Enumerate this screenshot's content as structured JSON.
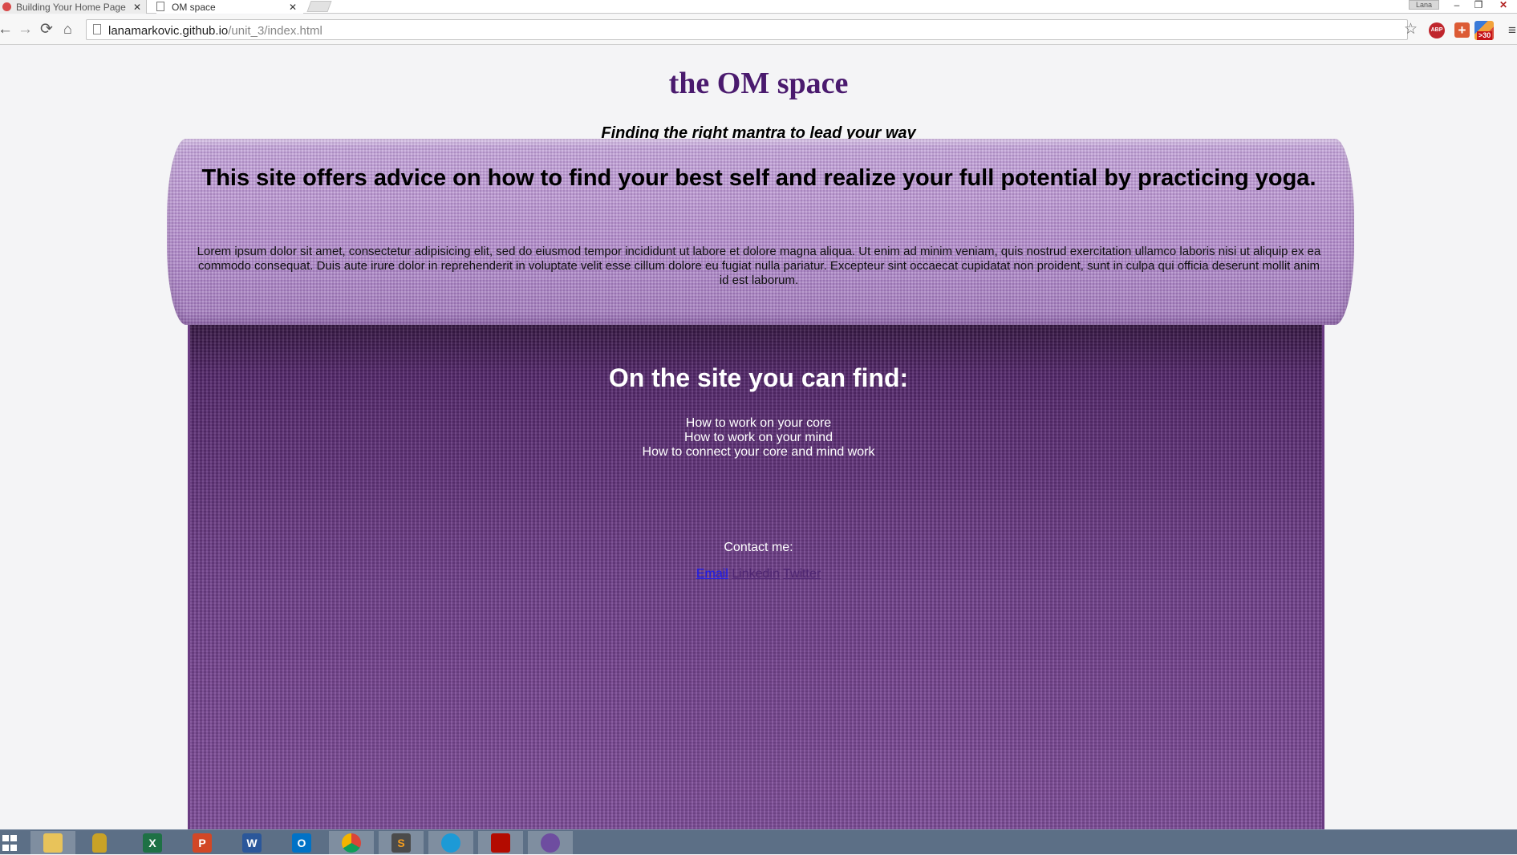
{
  "browser": {
    "tabs": [
      {
        "title": "Building Your Home Page",
        "active": false
      },
      {
        "title": "OM space",
        "active": true
      }
    ],
    "profile_name": "Lana",
    "url": {
      "host": "lanamarkovic.github.io",
      "path": "/unit_3/index.html"
    },
    "extensions": {
      "abp": "ABP",
      "chart_badge": ">30"
    },
    "close_glyph": "✕",
    "window": {
      "min": "–",
      "max": "❐",
      "close": "✕"
    },
    "nav": {
      "back": "←",
      "forward": "→",
      "reload": "⟳",
      "home": "⌂",
      "star": "☆",
      "menu": "≡"
    }
  },
  "page": {
    "title": "the OM space",
    "tagline": "Finding the right mantra to lead your way",
    "intro_heading": "This site offers advice on how to find your best self and realize your full potential by practicing yoga.",
    "intro_body": "Lorem ipsum dolor sit amet, consectetur adipisicing elit, sed do eiusmod tempor incididunt ut labore et dolore magna aliqua. Ut enim ad minim veniam, quis nostrud exercitation ullamco laboris nisi ut aliquip ex ea commodo consequat. Duis aute irure dolor in reprehenderit in voluptate velit esse cillum dolore eu fugiat nulla pariatur. Excepteur sint occaecat cupidatat non proident, sunt in culpa qui officia deserunt mollit anim id est laborum.",
    "find_heading": "On the site you can find:",
    "find_items": [
      "How to work on your core",
      "How to work on your mind",
      "How to connect your core and mind work"
    ],
    "contact_label": "Contact me:",
    "links": {
      "email": "Email",
      "linkedin": "Linkedin",
      "twitter": "Twitter"
    },
    "colors": {
      "title": "#4a1a6e",
      "mat_top": "#b792cf",
      "mat_body": "#71408c"
    }
  },
  "taskbar": {
    "items": [
      {
        "name": "start",
        "icon": "windows-icon"
      },
      {
        "name": "file-explorer",
        "icon": "folder-icon"
      },
      {
        "name": "security",
        "icon": "lock-icon"
      },
      {
        "name": "excel",
        "icon": "excel-icon",
        "glyph": "X"
      },
      {
        "name": "powerpoint",
        "icon": "powerpoint-icon",
        "glyph": "P"
      },
      {
        "name": "word",
        "icon": "word-icon",
        "glyph": "W"
      },
      {
        "name": "outlook",
        "icon": "outlook-icon",
        "glyph": "O"
      },
      {
        "name": "chrome",
        "icon": "chrome-icon"
      },
      {
        "name": "sublime",
        "icon": "sublime-icon",
        "glyph": "S"
      },
      {
        "name": "network",
        "icon": "network-icon"
      },
      {
        "name": "acrobat",
        "icon": "acrobat-icon"
      },
      {
        "name": "github",
        "icon": "github-icon"
      }
    ]
  }
}
